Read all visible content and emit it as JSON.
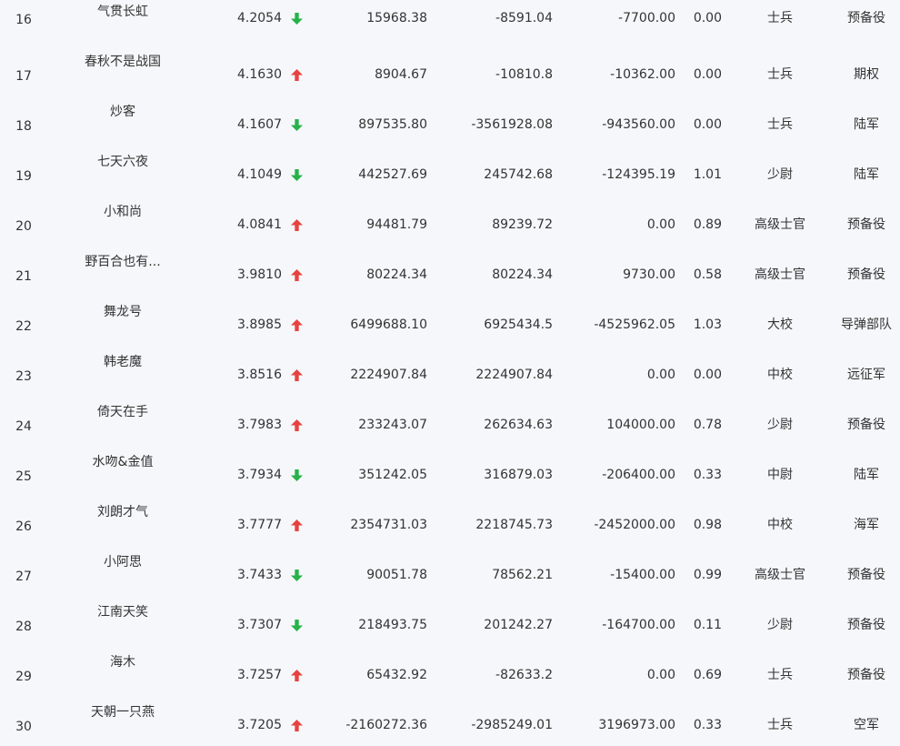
{
  "colors": {
    "up": "#e64340",
    "down": "#27b249",
    "text": "#333333",
    "background": "#f5f7fa"
  },
  "rows": [
    {
      "rank": "16",
      "name": "气贯长虹",
      "score": "4.2054",
      "trend": "down",
      "v1": "15968.38",
      "v2": "-8591.04",
      "v3": "-7700.00",
      "ratio": "0.00",
      "title": "士兵",
      "branch": "预备役"
    },
    {
      "rank": "17",
      "name": "春秋不是战国",
      "score": "4.1630",
      "trend": "up",
      "v1": "8904.67",
      "v2": "-10810.8",
      "v3": "-10362.00",
      "ratio": "0.00",
      "title": "士兵",
      "branch": "期权"
    },
    {
      "rank": "18",
      "name": "炒客",
      "score": "4.1607",
      "trend": "down",
      "v1": "897535.80",
      "v2": "-3561928.08",
      "v3": "-943560.00",
      "ratio": "0.00",
      "title": "士兵",
      "branch": "陆军"
    },
    {
      "rank": "19",
      "name": "七天六夜",
      "score": "4.1049",
      "trend": "down",
      "v1": "442527.69",
      "v2": "245742.68",
      "v3": "-124395.19",
      "ratio": "1.01",
      "title": "少尉",
      "branch": "陆军"
    },
    {
      "rank": "20",
      "name": "小和尚",
      "score": "4.0841",
      "trend": "up",
      "v1": "94481.79",
      "v2": "89239.72",
      "v3": "0.00",
      "ratio": "0.89",
      "title": "高级士官",
      "branch": "预备役"
    },
    {
      "rank": "21",
      "name": "野百合也有...",
      "score": "3.9810",
      "trend": "up",
      "v1": "80224.34",
      "v2": "80224.34",
      "v3": "9730.00",
      "ratio": "0.58",
      "title": "高级士官",
      "branch": "预备役"
    },
    {
      "rank": "22",
      "name": "舞龙号",
      "score": "3.8985",
      "trend": "up",
      "v1": "6499688.10",
      "v2": "6925434.5",
      "v3": "-4525962.05",
      "ratio": "1.03",
      "title": "大校",
      "branch": "导弹部队"
    },
    {
      "rank": "23",
      "name": "韩老魔",
      "score": "3.8516",
      "trend": "up",
      "v1": "2224907.84",
      "v2": "2224907.84",
      "v3": "0.00",
      "ratio": "0.00",
      "title": "中校",
      "branch": "远征军"
    },
    {
      "rank": "24",
      "name": "倚天在手",
      "score": "3.7983",
      "trend": "up",
      "v1": "233243.07",
      "v2": "262634.63",
      "v3": "104000.00",
      "ratio": "0.78",
      "title": "少尉",
      "branch": "预备役"
    },
    {
      "rank": "25",
      "name": "水吻&金值",
      "score": "3.7934",
      "trend": "down",
      "v1": "351242.05",
      "v2": "316879.03",
      "v3": "-206400.00",
      "ratio": "0.33",
      "title": "中尉",
      "branch": "陆军"
    },
    {
      "rank": "26",
      "name": "刘朗才气",
      "score": "3.7777",
      "trend": "up",
      "v1": "2354731.03",
      "v2": "2218745.73",
      "v3": "-2452000.00",
      "ratio": "0.98",
      "title": "中校",
      "branch": "海军"
    },
    {
      "rank": "27",
      "name": "小阿思",
      "score": "3.7433",
      "trend": "down",
      "v1": "90051.78",
      "v2": "78562.21",
      "v3": "-15400.00",
      "ratio": "0.99",
      "title": "高级士官",
      "branch": "预备役"
    },
    {
      "rank": "28",
      "name": "江南天笑",
      "score": "3.7307",
      "trend": "down",
      "v1": "218493.75",
      "v2": "201242.27",
      "v3": "-164700.00",
      "ratio": "0.11",
      "title": "少尉",
      "branch": "预备役"
    },
    {
      "rank": "29",
      "name": "海木",
      "score": "3.7257",
      "trend": "up",
      "v1": "65432.92",
      "v2": "-82633.2",
      "v3": "0.00",
      "ratio": "0.69",
      "title": "士兵",
      "branch": "预备役"
    },
    {
      "rank": "30",
      "name": "天朝一只燕",
      "score": "3.7205",
      "trend": "up",
      "v1": "-2160272.36",
      "v2": "-2985249.01",
      "v3": "3196973.00",
      "ratio": "0.33",
      "title": "士兵",
      "branch": "空军"
    }
  ]
}
